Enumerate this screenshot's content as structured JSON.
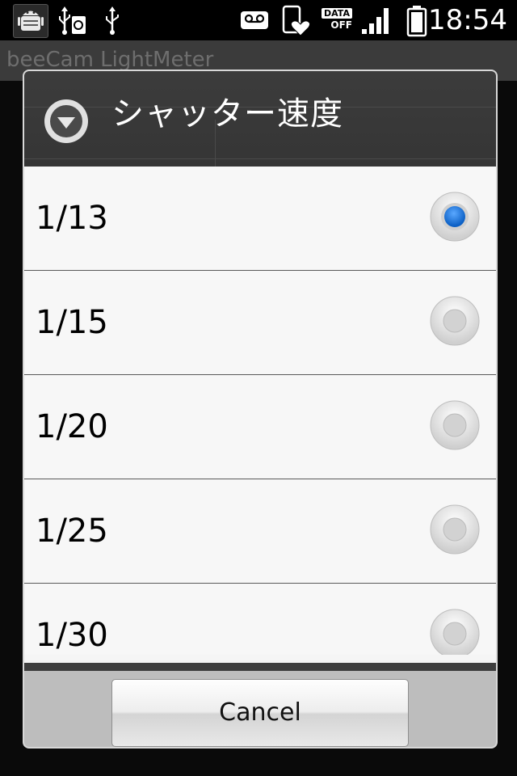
{
  "status_bar": {
    "time": "18:54",
    "data_label": "DATA",
    "data_state": "OFF",
    "icons": [
      "android-debug-icon",
      "usb-storage-icon",
      "usb-icon",
      "voicemail-icon",
      "phone-heart-icon",
      "data-off-icon",
      "signal-icon",
      "battery-icon"
    ]
  },
  "background_app": {
    "title": "beeCam LightMeter"
  },
  "dialog": {
    "title": "シャッター速度",
    "options": [
      {
        "label": "1/13",
        "selected": true
      },
      {
        "label": "1/15",
        "selected": false
      },
      {
        "label": "1/20",
        "selected": false
      },
      {
        "label": "1/25",
        "selected": false
      },
      {
        "label": "1/30",
        "selected": false
      }
    ],
    "cancel_label": "Cancel"
  },
  "colors": {
    "selected_radio": "#1a73d9",
    "dialog_header": "#3a3a3a",
    "list_background": "#f7f7f7",
    "button_area": "#bdbdbd"
  }
}
